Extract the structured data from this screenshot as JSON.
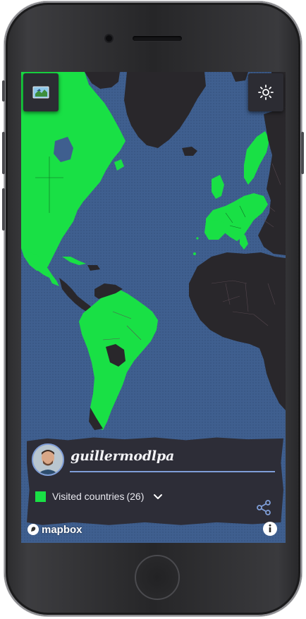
{
  "profile": {
    "username": "guillermodlpa",
    "avatar_icon": "user-avatar"
  },
  "legend": {
    "label": "Visited countries",
    "count": "(26)",
    "swatch_color": "#19e045"
  },
  "map": {
    "ocean_color": "#3f5f8f",
    "land_color": "#29272b",
    "visited_color": "#19e045",
    "attribution": "mapbox"
  },
  "controls": {
    "layers_icon": "map-layers-icon",
    "theme_icon": "sun-icon",
    "share_icon": "share-icon",
    "expand_icon": "chevron-down-icon",
    "info_icon": "info-icon"
  }
}
